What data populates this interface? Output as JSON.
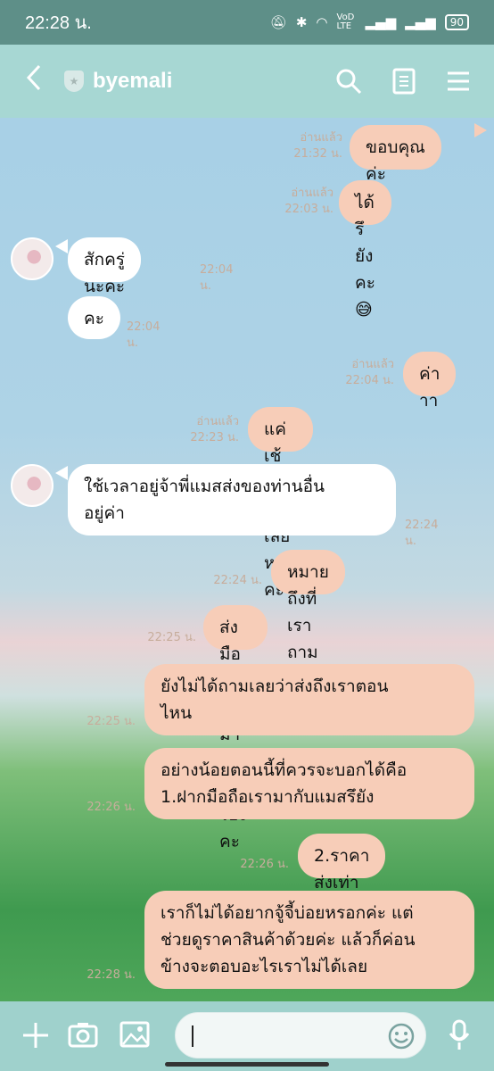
{
  "status_bar": {
    "time": "22:28 น.",
    "network_label": "VoD LTE",
    "battery": "90"
  },
  "header": {
    "contact_name": "byemali"
  },
  "messages": [
    {
      "side": "out",
      "text": "ขอบคุณค่ะ",
      "read": "อ่านแล้ว",
      "time": "21:32 น."
    },
    {
      "side": "out",
      "text": "ได้รึยังคะ😅",
      "read": "อ่านแล้ว",
      "time": "22:03 น."
    },
    {
      "side": "in",
      "text": "สักครู่นะคะ",
      "time": "22:04 น."
    },
    {
      "side": "in",
      "text": "คะ",
      "time": "22:04 น."
    },
    {
      "side": "out",
      "text": "ค่าาา",
      "read": "อ่านแล้ว",
      "time": "22:04 น."
    },
    {
      "side": "out",
      "text": "แค่เช้คนี่นานเลยหรอคะ",
      "read": "อ่านแล้ว",
      "time": "22:23 น."
    },
    {
      "side": "in",
      "text": "ใช้เวลาอยู่จ้าพี่แมสส่งของท่านอื่น\nอยู่ค่า",
      "time": "22:24 น."
    },
    {
      "side": "out",
      "text": "หมายถึงที่เราถามคือ",
      "time": "22:24 น."
    },
    {
      "side": "out",
      "text": "ส่งมือถือเรามากับแมสรึยังคะ",
      "time": "22:25 น."
    },
    {
      "side": "out",
      "text": "ยังไม่ได้ถามเลยว่าส่งถึงเราตอน\nไหน",
      "time": "22:25 น."
    },
    {
      "side": "out",
      "text": "อย่างน้อยตอนนี้ที่ควรจะบอกได้คือ\n1.ฝากมือถือเรามากับแมสรึยัง",
      "time": "22:26 น."
    },
    {
      "side": "out",
      "text": "2.ราคาส่งเท่าไหร่",
      "time": "22:26 น."
    },
    {
      "side": "out",
      "text": "เราก็ไม่ได้อยากจู้จี้บ่อยหรอกค่ะ แต่\nช่วยดูราคาสินค้าด้วยค่ะ แล้วก็ค่อน\nข้างจะตอบอะไรเราไม่ได้เลย",
      "time": "22:28 น."
    }
  ],
  "colors": {
    "header_bg": "#a7d7d3",
    "status_bg": "#5e8f88",
    "outgoing_bubble": "#f7cdb8",
    "incoming_bubble": "#ffffff"
  },
  "icons": [
    "back-icon",
    "shield-icon",
    "search-icon",
    "notes-icon",
    "menu-icon",
    "plus-icon",
    "camera-icon",
    "image-icon",
    "emoji-icon",
    "mic-icon"
  ]
}
